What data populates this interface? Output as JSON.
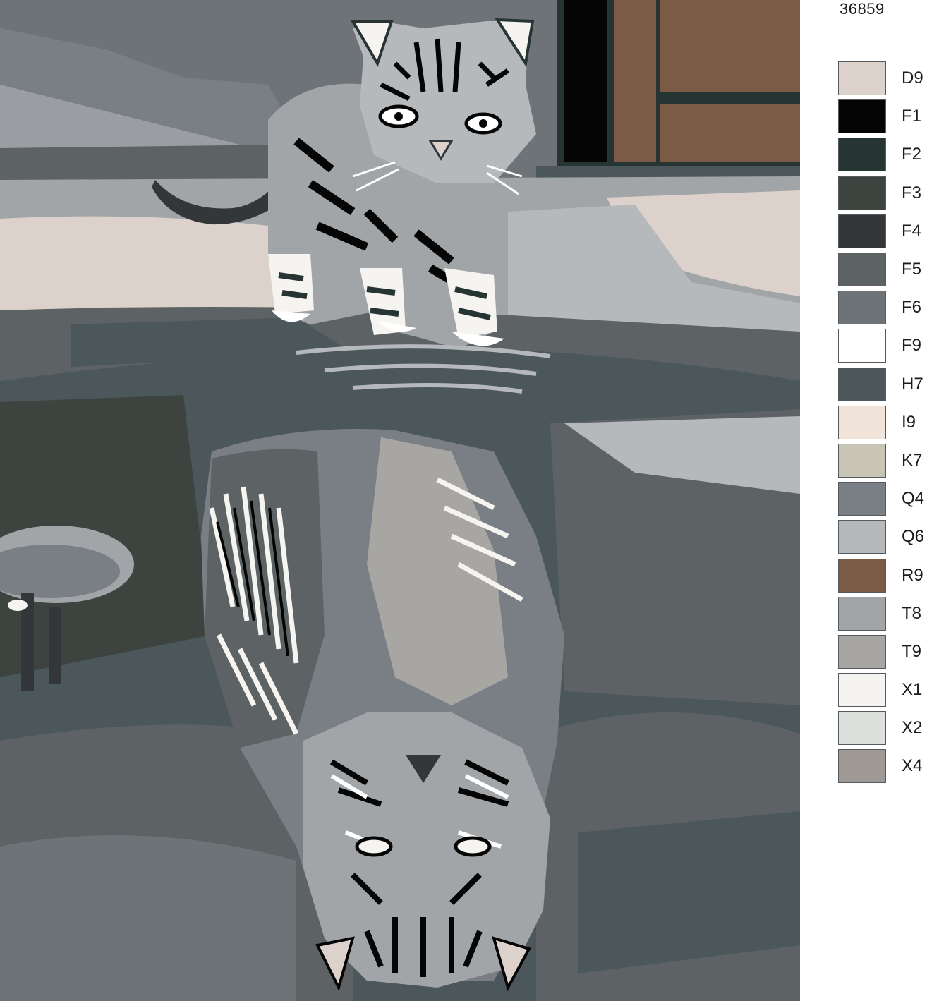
{
  "product_code": "36859",
  "legend": [
    {
      "code": "D9",
      "color": "#ddd2cb",
      "swatch-icon": "color-swatch"
    },
    {
      "code": "F1",
      "color": "#050505",
      "swatch-icon": "color-swatch"
    },
    {
      "code": "F2",
      "color": "#263434",
      "swatch-icon": "color-swatch"
    },
    {
      "code": "F3",
      "color": "#3d4440",
      "swatch-icon": "color-swatch"
    },
    {
      "code": "F4",
      "color": "#333739",
      "swatch-icon": "color-swatch"
    },
    {
      "code": "F5",
      "color": "#5d6365",
      "swatch-icon": "color-swatch"
    },
    {
      "code": "F6",
      "color": "#6e7377",
      "swatch-icon": "color-swatch"
    },
    {
      "code": "F9",
      "color": "#ffffff",
      "swatch-icon": "color-swatch"
    },
    {
      "code": "H7",
      "color": "#4c575c",
      "swatch-icon": "color-swatch"
    },
    {
      "code": "I9",
      "color": "#f0e4da",
      "swatch-icon": "color-swatch"
    },
    {
      "code": "K7",
      "color": "#c8c4b6",
      "swatch-icon": "color-swatch"
    },
    {
      "code": "Q4",
      "color": "#7a7f85",
      "swatch-icon": "color-swatch"
    },
    {
      "code": "Q6",
      "color": "#b6b9bc",
      "swatch-icon": "color-swatch"
    },
    {
      "code": "R9",
      "color": "#7b5a46",
      "swatch-icon": "color-swatch"
    },
    {
      "code": "T8",
      "color": "#a2a5a7",
      "swatch-icon": "color-swatch"
    },
    {
      "code": "T9",
      "color": "#a7a6a3",
      "swatch-icon": "color-swatch"
    },
    {
      "code": "X1",
      "color": "#f5f4f1",
      "swatch-icon": "color-swatch"
    },
    {
      "code": "X2",
      "color": "#dde1de",
      "swatch-icon": "color-swatch"
    },
    {
      "code": "X4",
      "color": "#9e9995",
      "swatch-icon": "color-swatch"
    }
  ]
}
